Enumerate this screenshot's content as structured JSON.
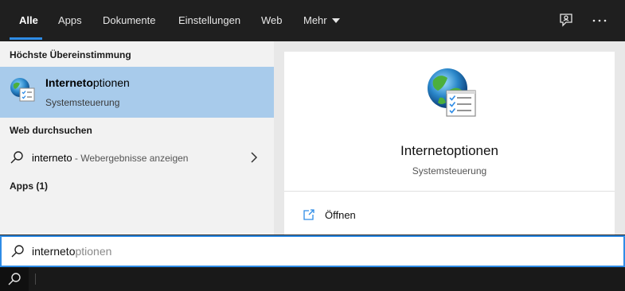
{
  "nav": {
    "tabs": [
      {
        "label": "Alle",
        "active": true
      },
      {
        "label": "Apps",
        "active": false
      },
      {
        "label": "Dokumente",
        "active": false
      },
      {
        "label": "Einstellungen",
        "active": false
      },
      {
        "label": "Web",
        "active": false
      },
      {
        "label": "Mehr",
        "active": false
      }
    ],
    "icons": [
      "feedback-icon",
      "more-options-icon"
    ]
  },
  "results": {
    "best_match_header": "Höchste Übereinstimmung",
    "best_match": {
      "title_bold": "Interneto",
      "title_rest": "ptionen",
      "subtitle": "Systemsteuerung",
      "icon": "internet-options-globe-icon"
    },
    "web_header": "Web durchsuchen",
    "web_row": {
      "term": "interneto",
      "hint": " - Webergebnisse anzeigen",
      "icon": "search-icon"
    },
    "apps_header": "Apps (1)"
  },
  "detail": {
    "name": "Internetoptionen",
    "type": "Systemsteuerung",
    "action_open": "Öffnen",
    "icon": "internet-options-globe-icon"
  },
  "search": {
    "typed": "interneto",
    "completion": "ptionen"
  },
  "colors": {
    "accent": "#2e8ce6",
    "selected_bg": "#a8cbeb",
    "topbar_bg": "#1f1f1f"
  }
}
